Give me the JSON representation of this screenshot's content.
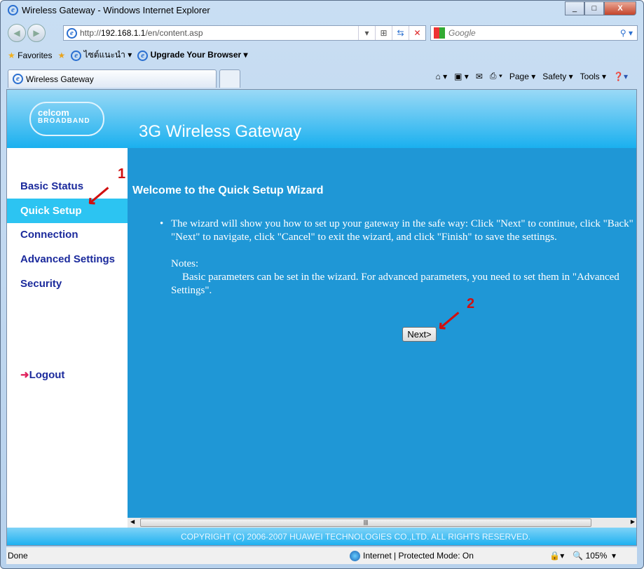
{
  "window": {
    "title": "Wireless Gateway - Windows Internet Explorer",
    "minimize": "_",
    "maximize": "□",
    "close": "X"
  },
  "address": {
    "prefix": "http://",
    "host": "192.168.1.1",
    "path": "/en/content.asp"
  },
  "search": {
    "placeholder": "Google"
  },
  "favorites": {
    "label": "Favorites",
    "link1": "ไซต์แนะนำ",
    "link2": "Upgrade Your Browser"
  },
  "tab": {
    "label": "Wireless Gateway"
  },
  "commands": {
    "page": "Page ▾",
    "safety": "Safety ▾",
    "tools": "Tools ▾"
  },
  "header": {
    "logo_top": "celcom",
    "logo_bottom": "BROADBAND",
    "title": "3G Wireless Gateway"
  },
  "sidebar": {
    "items": [
      {
        "label": "Basic Status"
      },
      {
        "label": "Quick Setup"
      },
      {
        "label": "Connection"
      },
      {
        "label": "Advanced Settings"
      },
      {
        "label": "Security"
      }
    ],
    "logout": "Logout"
  },
  "main": {
    "title": "Welcome to the Quick Setup Wizard",
    "text": "The wizard will show you how to set up your gateway in the safe way: Click \"Next\" to continue, click \"Back\" and \"Next\" to navigate, click \"Cancel\" to exit the wizard, and click \"Finish\" to save the settings.",
    "notes_label": "Notes:",
    "notes_text": "Basic parameters can be set in the wizard. For advanced parameters, you need to set them in \"Advanced Settings\".",
    "next_button": "Next>",
    "annotation1": "1",
    "annotation2": "2"
  },
  "footer": {
    "copyright": "COPYRIGHT (C) 2006-2007 HUAWEI TECHNOLOGIES CO.,LTD. ALL RIGHTS RESERVED."
  },
  "statusbar": {
    "status": "Done",
    "zone": "Internet | Protected Mode: On",
    "zoom": "105%"
  }
}
